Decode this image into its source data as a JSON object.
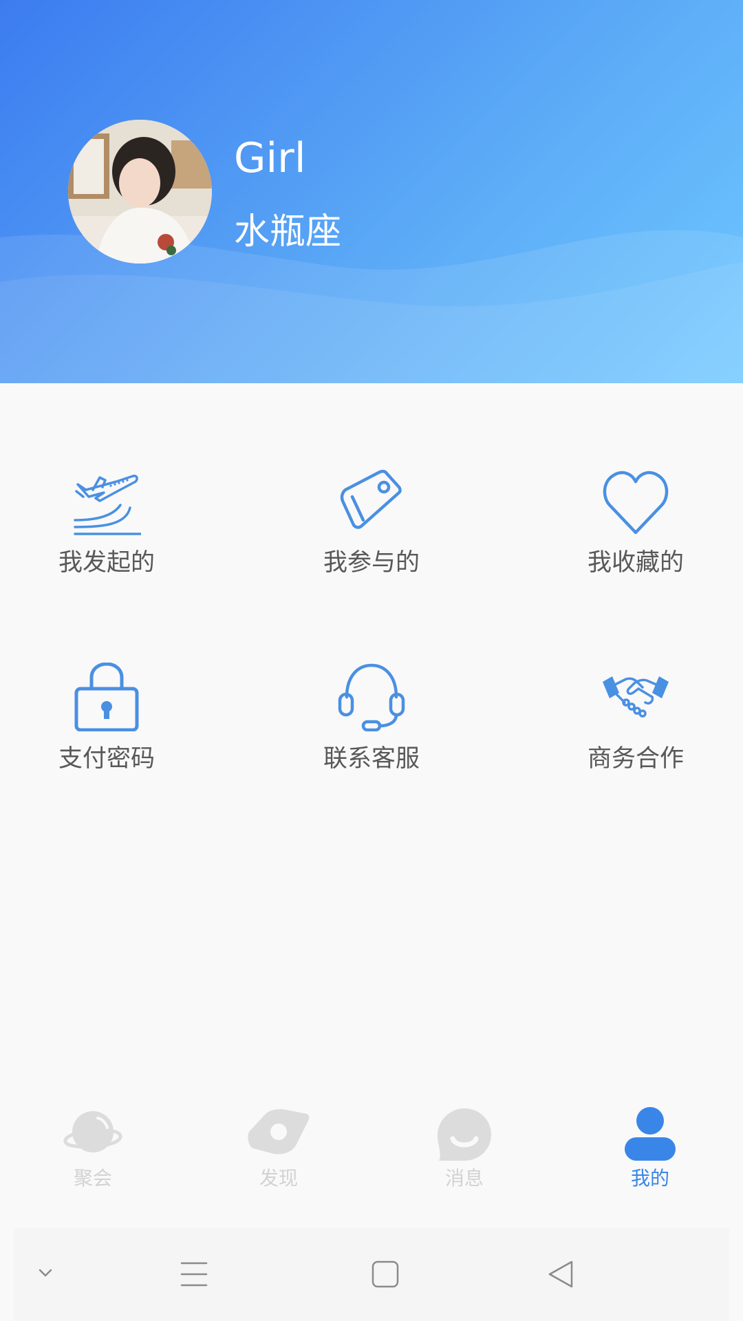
{
  "profile": {
    "name": "Girl",
    "sign": "水瓶座"
  },
  "menu": [
    {
      "label": "我发起的",
      "icon": "airplane-takeoff-icon"
    },
    {
      "label": "我参与的",
      "icon": "tag-icon"
    },
    {
      "label": "我收藏的",
      "icon": "heart-icon"
    },
    {
      "label": "支付密码",
      "icon": "lock-icon"
    },
    {
      "label": "联系客服",
      "icon": "headset-icon"
    },
    {
      "label": "商务合作",
      "icon": "handshake-icon"
    }
  ],
  "tabs": [
    {
      "label": "聚会",
      "icon": "planet-icon",
      "active": false
    },
    {
      "label": "发现",
      "icon": "eye-icon",
      "active": false
    },
    {
      "label": "消息",
      "icon": "smile-bubble-icon",
      "active": false
    },
    {
      "label": "我的",
      "icon": "person-icon",
      "active": true
    }
  ],
  "colors": {
    "accent": "#3a86e8",
    "icon_blue": "#4a90e2",
    "tab_inactive": "#d2d2d2",
    "header_start": "#3c7cf0",
    "header_end": "#6ec8ff"
  },
  "system_nav": [
    "chevron-down-icon",
    "menu-icon",
    "home-square-icon",
    "back-triangle-icon"
  ]
}
